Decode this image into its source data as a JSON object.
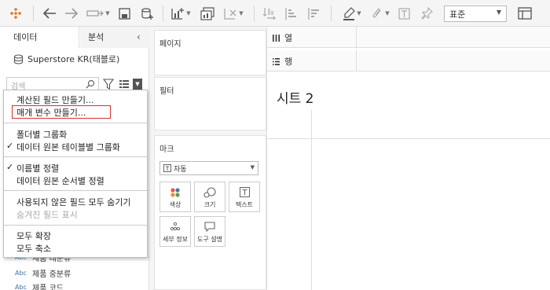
{
  "toolbar": {
    "format_select": "표준"
  },
  "left_panel": {
    "tabs": [
      "데이터",
      "분석"
    ],
    "datasource": "Superstore KR(태블로)",
    "search_placeholder": "검색",
    "fields": [
      {
        "type": "Abc",
        "name": "제품 대분류"
      },
      {
        "type": "Abc",
        "name": "제품 중분류"
      },
      {
        "type": "Abc",
        "name": "제품 코드"
      }
    ]
  },
  "context_menu": {
    "items": [
      {
        "label": "계산된 필드 만들기...",
        "checked": false,
        "disabled": false
      },
      {
        "label": "매개 변수 만들기...",
        "checked": false,
        "disabled": false,
        "highlighted": true
      },
      {
        "label": "폴더별 그룹화",
        "checked": false,
        "disabled": false
      },
      {
        "label": "데이터 원본 테이블별 그룹화",
        "checked": true,
        "disabled": false
      },
      {
        "label": "이름별 정렬",
        "checked": true,
        "disabled": false
      },
      {
        "label": "데이터 원본 순서별 정렬",
        "checked": false,
        "disabled": false
      },
      {
        "label": "사용되지 않은 필드 모두 숨기기",
        "checked": false,
        "disabled": false
      },
      {
        "label": "숨겨진 필드 표시",
        "checked": false,
        "disabled": true
      },
      {
        "label": "모두 확장",
        "checked": false,
        "disabled": false
      },
      {
        "label": "모두 축소",
        "checked": false,
        "disabled": false
      }
    ]
  },
  "middle": {
    "pages_title": "페이지",
    "filters_title": "필터",
    "marks_title": "마크",
    "mark_type": "자동",
    "mark_buttons": [
      "색상",
      "크기",
      "텍스트",
      "세부 정보",
      "도구 설명"
    ]
  },
  "right": {
    "columns_label": "열",
    "rows_label": "행",
    "sheet_title": "시트 2"
  },
  "colors": {
    "highlight_border": "#d9302c",
    "abc_blue": "#3973ac",
    "color_dots": [
      "#e15759",
      "#4e79a7",
      "#f28e2b",
      "#59a14f"
    ]
  }
}
